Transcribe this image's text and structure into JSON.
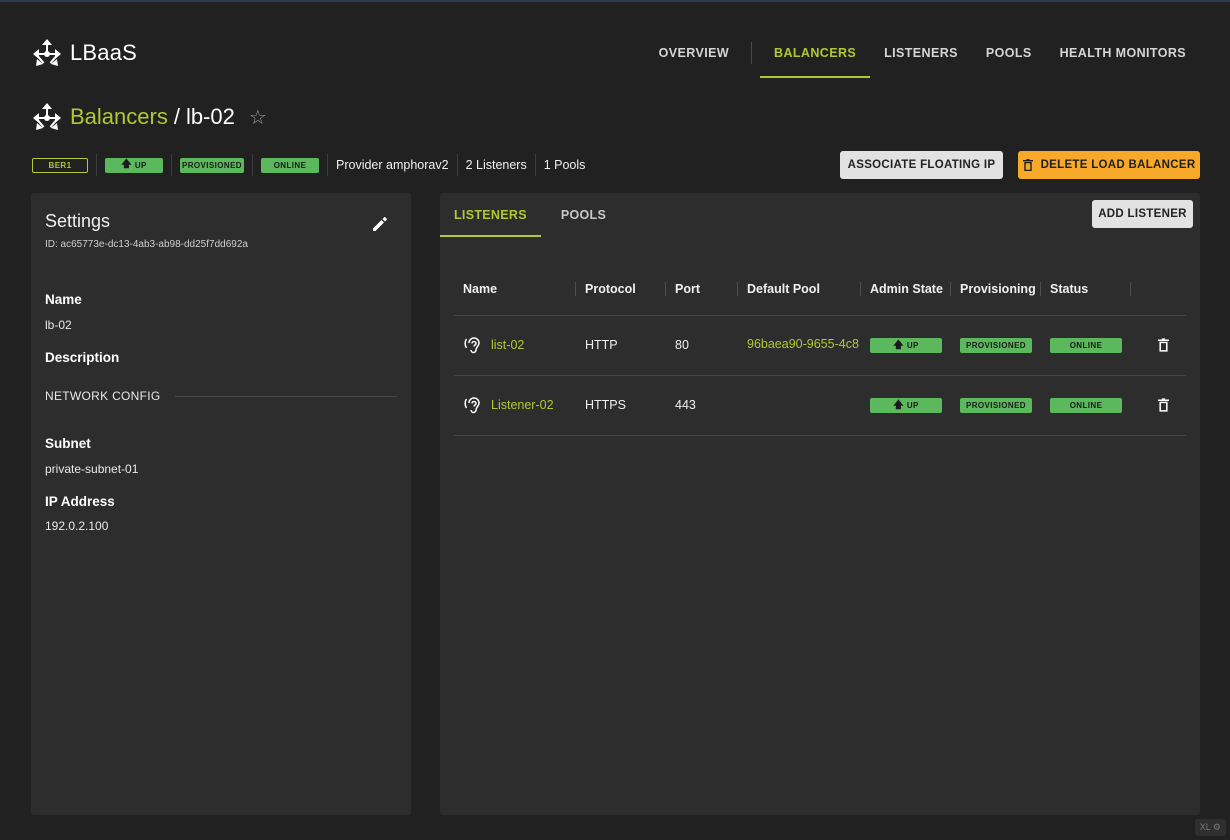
{
  "app": {
    "title": "LBaaS"
  },
  "nav": {
    "items": [
      {
        "label": "OVERVIEW",
        "active": false
      },
      {
        "label": "BALANCERS",
        "active": true
      },
      {
        "label": "LISTENERS",
        "active": false
      },
      {
        "label": "POOLS",
        "active": false
      },
      {
        "label": "HEALTH MONITORS",
        "active": false
      }
    ]
  },
  "breadcrumb": {
    "parent": "Balancers",
    "separator": "/",
    "current": "lb-02",
    "favorite_icon": "star-outline-icon"
  },
  "status": {
    "region": "BER1",
    "admin_state": "UP",
    "provisioning": "PROVISIONED",
    "operating": "ONLINE",
    "provider": "Provider amphorav2",
    "listeners": "2 Listeners",
    "pools": "1 Pools"
  },
  "actions": {
    "associate": "ASSOCIATE FLOATING IP",
    "delete": "DELETE LOAD BALANCER"
  },
  "settings": {
    "title": "Settings",
    "id": "ID: ac65773e-dc13-4ab3-ab98-dd25f7dd692a",
    "name_label": "Name",
    "name_value": "lb-02",
    "description_label": "Description",
    "network_config": "NETWORK CONFIG",
    "subnet_label": "Subnet",
    "subnet_value": "private-subnet-01",
    "ip_label": "IP Address",
    "ip_value": "192.0.2.100"
  },
  "panel": {
    "tabs": [
      {
        "label": "LISTENERS",
        "active": true
      },
      {
        "label": "POOLS",
        "active": false
      }
    ],
    "add_button": "ADD LISTENER",
    "columns": [
      "Name",
      "Protocol",
      "Port",
      "Default Pool",
      "Admin State",
      "Provisioning",
      "Status"
    ],
    "rows": [
      {
        "name": "list-02",
        "protocol": "HTTP",
        "port": "80",
        "default_pool": "96baea90-9655-4c8",
        "admin_state": "UP",
        "provisioning": "PROVISIONED",
        "status": "ONLINE"
      },
      {
        "name": "Listener-02",
        "protocol": "HTTPS",
        "port": "443",
        "default_pool": "",
        "admin_state": "UP",
        "provisioning": "PROVISIONED",
        "status": "ONLINE"
      }
    ]
  },
  "colors": {
    "accent": "#afc933",
    "success": "#5cb85c",
    "warning": "#f8a92a",
    "background": "#212121",
    "panel": "#2d2d2d"
  },
  "corner_badge": "XL"
}
